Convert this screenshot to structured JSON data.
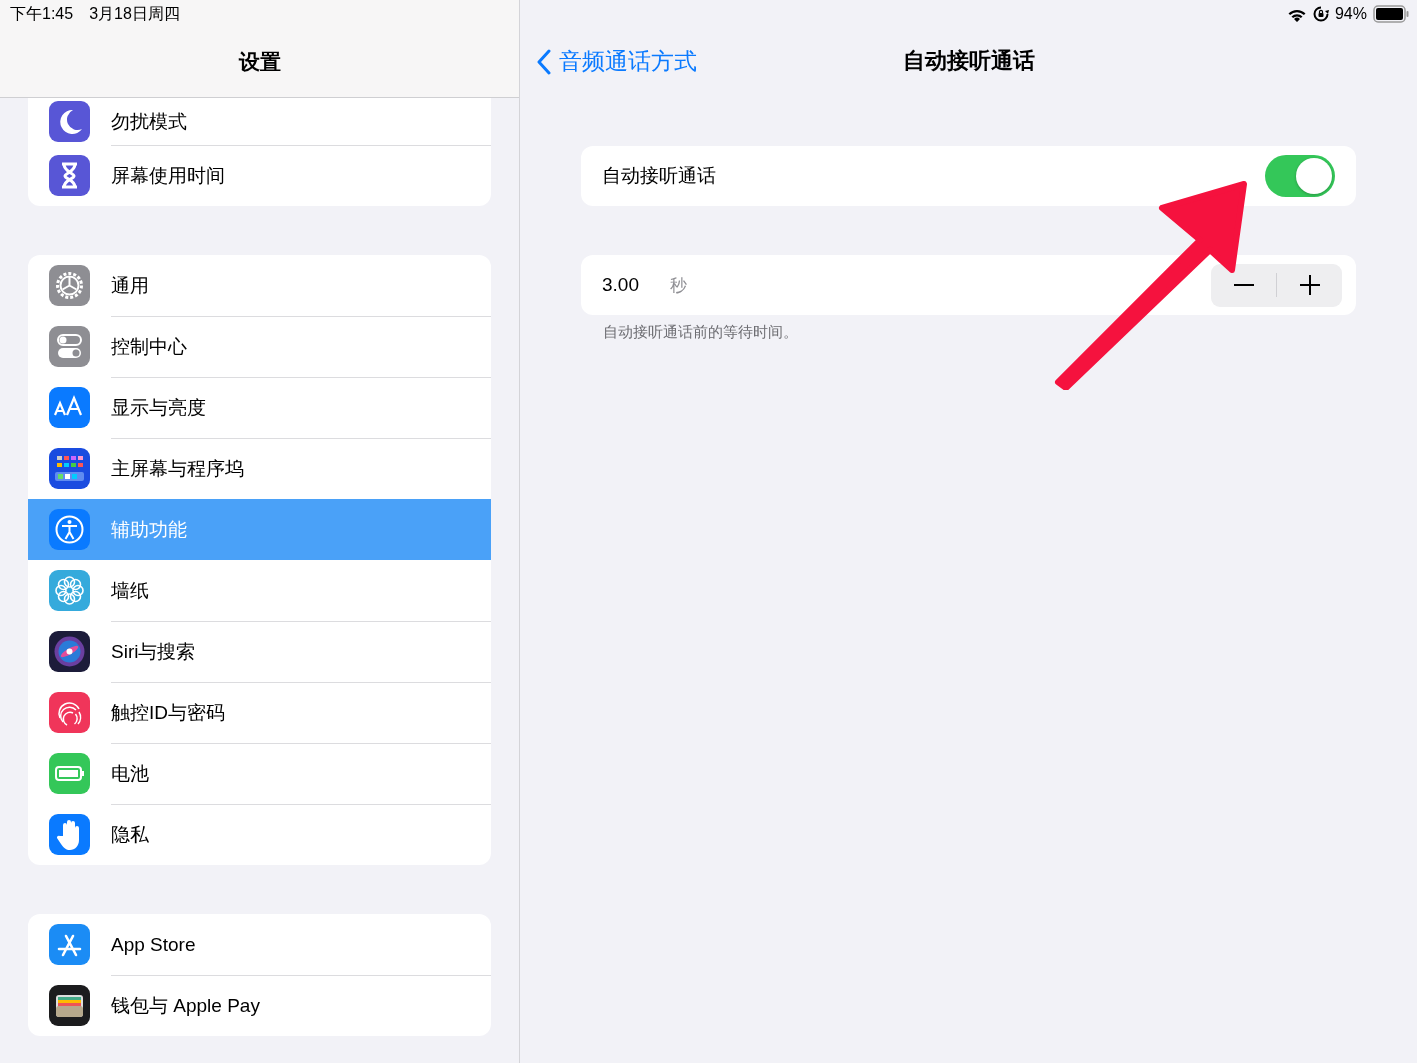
{
  "status_bar": {
    "time": "下午1:45",
    "date": "3月18日周四",
    "battery": "94%"
  },
  "sidebar": {
    "title": "设置",
    "groups": [
      {
        "items": [
          {
            "label": "勿扰模式",
            "selected": false
          },
          {
            "label": "屏幕使用时间",
            "selected": false
          }
        ]
      },
      {
        "items": [
          {
            "label": "通用",
            "selected": false
          },
          {
            "label": "控制中心",
            "selected": false
          },
          {
            "label": "显示与亮度",
            "selected": false
          },
          {
            "label": "主屏幕与程序坞",
            "selected": false
          },
          {
            "label": "辅助功能",
            "selected": true
          },
          {
            "label": "墙纸",
            "selected": false
          },
          {
            "label": "Siri与搜索",
            "selected": false
          },
          {
            "label": "触控ID与密码",
            "selected": false
          },
          {
            "label": "电池",
            "selected": false
          },
          {
            "label": "隐私",
            "selected": false
          }
        ]
      },
      {
        "items": [
          {
            "label": "App Store",
            "selected": false
          },
          {
            "label": "钱包与 Apple Pay",
            "selected": false
          }
        ]
      }
    ]
  },
  "detail": {
    "back": "音频通话方式",
    "title": "自动接听通话",
    "toggle": {
      "label": "自动接听通话",
      "on": true
    },
    "stepper": {
      "value": "3.00",
      "unit": "秒"
    },
    "footer": "自动接听通话前的等待时间。"
  }
}
